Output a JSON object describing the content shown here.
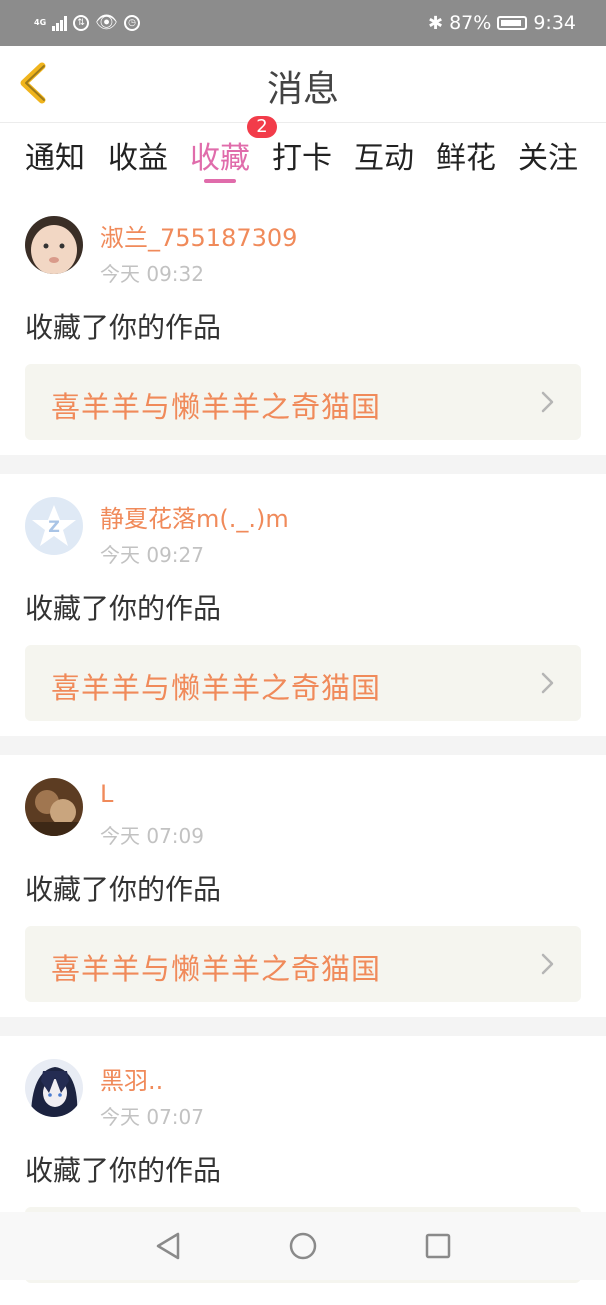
{
  "status_bar": {
    "network": "4G",
    "battery": "87%",
    "time": "9:34"
  },
  "header": {
    "title": "消息"
  },
  "tabs": [
    {
      "label": "通知"
    },
    {
      "label": "收益"
    },
    {
      "label": "收藏"
    },
    {
      "label": "打卡"
    },
    {
      "label": "互动"
    },
    {
      "label": "鲜花"
    },
    {
      "label": "关注"
    }
  ],
  "active_tab": "收藏",
  "badge": {
    "count": "2"
  },
  "messages": [
    {
      "user": "淑兰_755187309",
      "time": "今天 09:32",
      "action": "收藏了你的作品",
      "work": "喜羊羊与懒羊羊之奇猫国"
    },
    {
      "user": "静夏花落m(._.)m",
      "time": "今天 09:27",
      "action": "收藏了你的作品",
      "work": "喜羊羊与懒羊羊之奇猫国"
    },
    {
      "user": "L",
      "time": "今天 07:09",
      "action": "收藏了你的作品",
      "work": "喜羊羊与懒羊羊之奇猫国"
    },
    {
      "user": "黑羽..",
      "time": "今天 07:07",
      "action": "收藏了你的作品",
      "work": ""
    }
  ],
  "colors": {
    "accent_pink": "#e06cab",
    "username_orange": "#f08a5a",
    "badge_red": "#f23c4a",
    "back_icon_yellow": "#f0b41c"
  },
  "icons": {
    "back": "chevron-left-icon",
    "work_arrow": "chevron-right-icon",
    "nav_back": "triangle-back-icon",
    "nav_home": "circle-home-icon",
    "nav_recent": "square-recent-icon"
  }
}
